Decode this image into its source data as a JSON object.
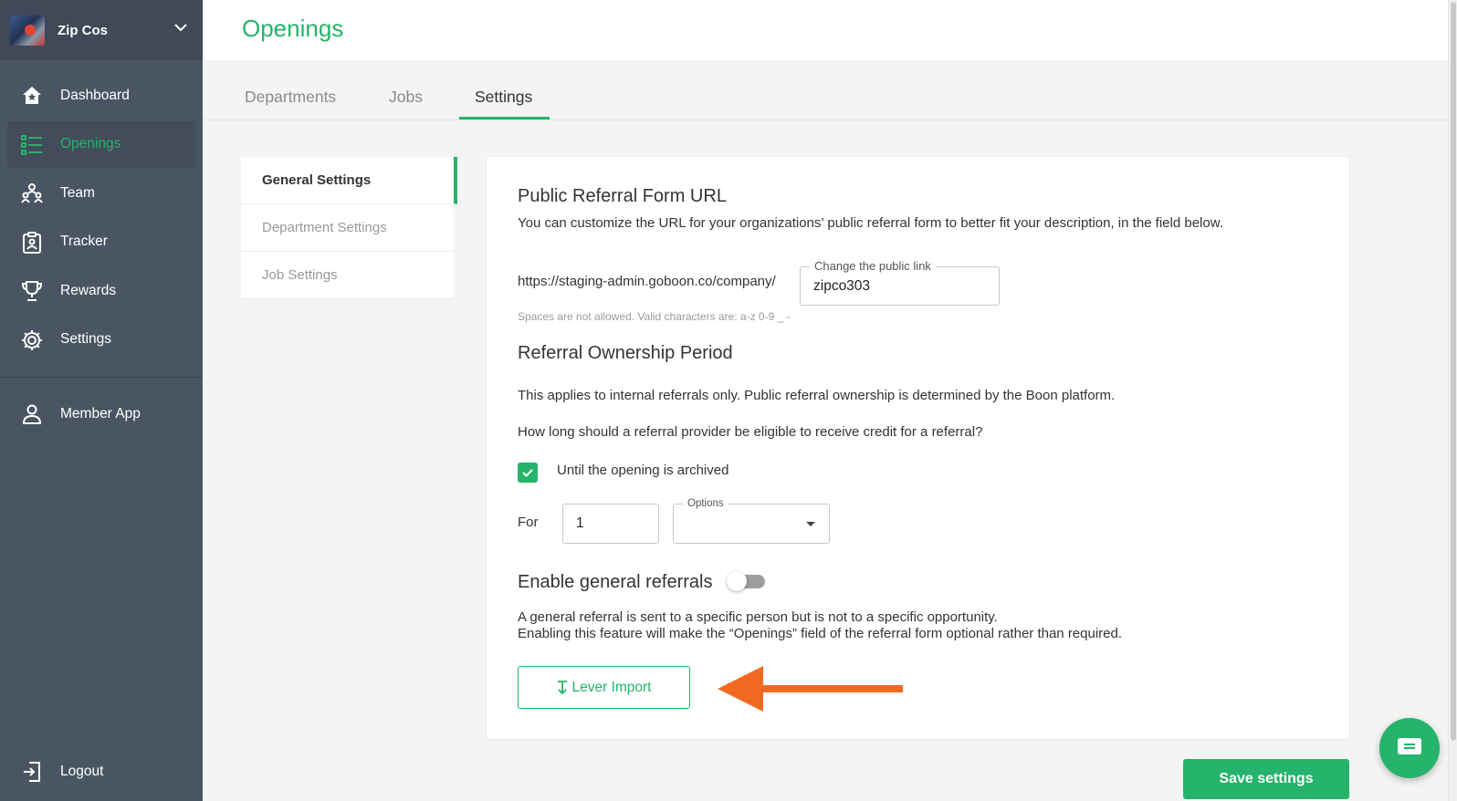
{
  "org": {
    "name": "Zip Cos"
  },
  "nav": [
    {
      "label": "Dashboard",
      "icon": "home-icon"
    },
    {
      "label": "Openings",
      "icon": "list-icon",
      "active": true
    },
    {
      "label": "Team",
      "icon": "team-icon"
    },
    {
      "label": "Tracker",
      "icon": "clipboard-icon"
    },
    {
      "label": "Rewards",
      "icon": "trophy-icon"
    },
    {
      "label": "Settings",
      "icon": "gear-icon"
    }
  ],
  "member_app": {
    "label": "Member App",
    "icon": "person-icon"
  },
  "logout": {
    "label": "Logout",
    "icon": "logout-icon"
  },
  "page": {
    "title": "Openings"
  },
  "tabs": [
    {
      "label": "Departments"
    },
    {
      "label": "Jobs"
    },
    {
      "label": "Settings",
      "active": true
    }
  ],
  "settings_menu": [
    {
      "label": "General Settings",
      "active": true
    },
    {
      "label": "Department Settings"
    },
    {
      "label": "Job Settings"
    }
  ],
  "public_url": {
    "heading": "Public Referral Form URL",
    "description": "You can customize the URL for your organizations’ public referral form to better fit your description, in the field below.",
    "prefix": "https://staging-admin.goboon.co/company/",
    "field_label": "Change the public link",
    "field_value": "zipco303",
    "hint": "Spaces are not allowed. Valid characters are: a-z 0-9 _ -"
  },
  "ownership": {
    "heading": "Referral Ownership Period",
    "note": "This applies to internal referrals only. Public referral ownership is determined by the Boon platform.",
    "question": "How long should a referral provider be eligible to receive credit for a referral?",
    "checkbox_label": "Until the opening is archived",
    "checkbox_checked": true,
    "for_label": "For",
    "for_value": "1",
    "options_label": "Options",
    "options_value": ""
  },
  "general_referrals": {
    "heading": "Enable general referrals",
    "enabled": false,
    "line1": "A general referral is sent to a specific person but is not to a specific opportunity.",
    "line2": "Enabling this feature will make the “Openings” field of the referral form optional rather than required."
  },
  "lever_import": {
    "label": "Lever Import",
    "icon": "download-icon"
  },
  "save_button": {
    "label": "Save settings"
  },
  "colors": {
    "brand": "#26b36b",
    "sidebar": "#4a5564",
    "annotation_arrow": "#f26a21"
  }
}
